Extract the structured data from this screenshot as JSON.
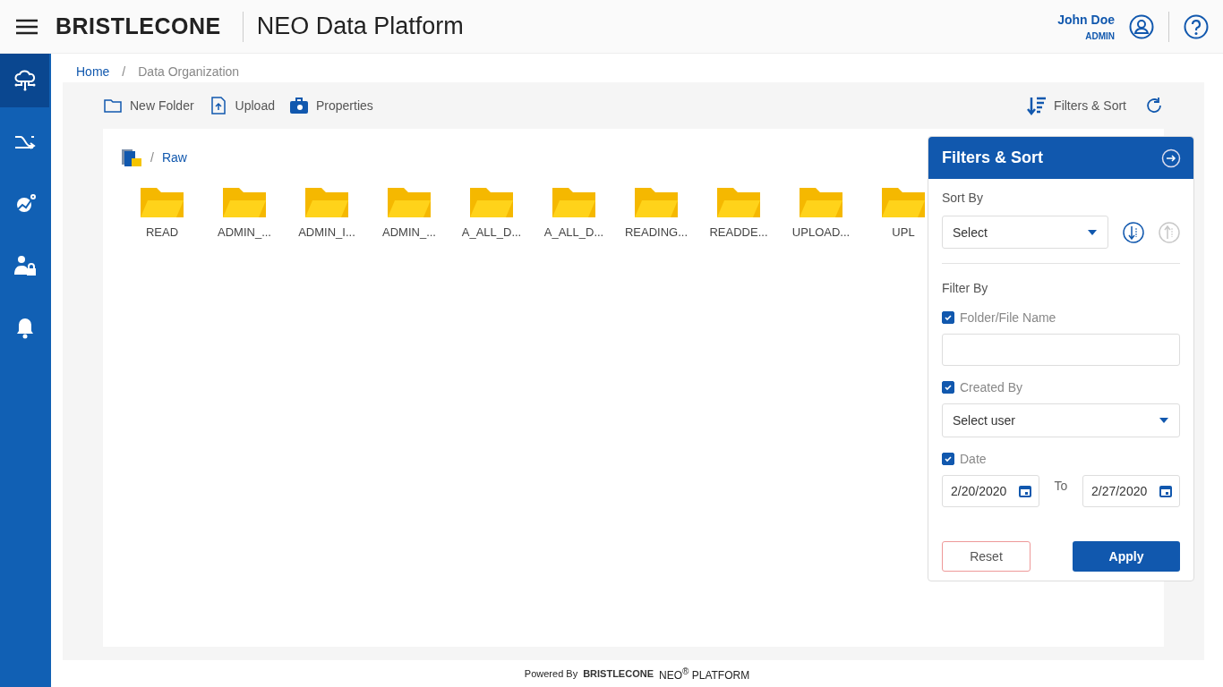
{
  "header": {
    "logo": "BRISTLECONE",
    "title": "NEO Data Platform",
    "user": {
      "name": "John Doe",
      "role": "ADMIN"
    }
  },
  "sidebar": {
    "items": [
      {
        "selected": true
      },
      {
        "selected": false
      },
      {
        "selected": false
      },
      {
        "selected": false
      },
      {
        "selected": false
      }
    ]
  },
  "breadcrumb": [
    "Home",
    "Data Organization"
  ],
  "separator": "/",
  "toolbar": {
    "actions": [
      "New Folder",
      "Upload",
      "Properties"
    ],
    "filters_button": "Filters & Sort"
  },
  "path": {
    "separator": "/",
    "items": [
      "Raw"
    ]
  },
  "folders": [
    "READ",
    "ADMIN_...",
    "ADMIN_I...",
    "ADMIN_...",
    "A_ALL_D...",
    "A_ALL_D...",
    "READING...",
    "READDE...",
    "UPLOAD...",
    "UPL"
  ],
  "filters_panel": {
    "title": "Filters & Sort",
    "sort_by": {
      "label": "Sort By",
      "value": "Select"
    },
    "sort_order": [
      {
        "selected": true
      },
      {
        "selected": false
      }
    ],
    "filter_by": "Filter By",
    "filters": [
      {
        "kind": "text",
        "label": "Folder/File Name",
        "checked": true
      },
      {
        "kind": "select",
        "label": "Created By",
        "checked": true,
        "value": "Select user"
      },
      {
        "kind": "date_range",
        "label": "Date",
        "checked": true,
        "from": "2/20/2020",
        "separator": "To",
        "to": "2/27/2020"
      }
    ],
    "buttons": [
      {
        "label": "Reset",
        "kind": "secondary"
      },
      {
        "label": "Apply",
        "kind": "primary"
      }
    ]
  },
  "footer": {
    "powered_by": "Powered By",
    "brand": "BRISTLECONE",
    "product": "NEO$^{®}$ PLATFORM"
  }
}
